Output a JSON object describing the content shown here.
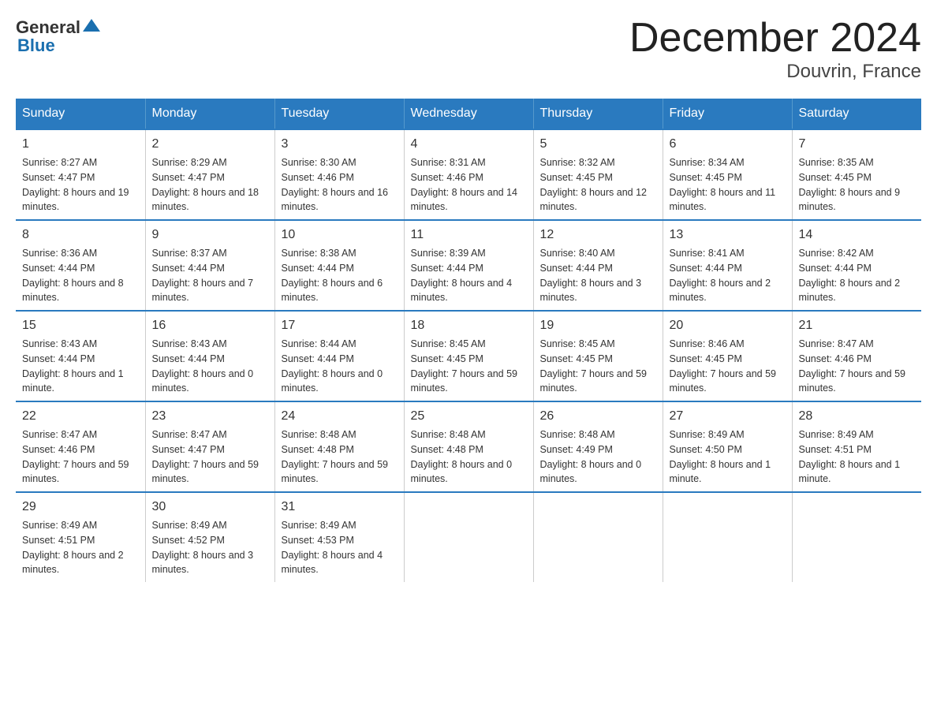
{
  "header": {
    "logo_text1": "General",
    "logo_text2": "Blue",
    "month": "December 2024",
    "location": "Douvrin, France"
  },
  "days_of_week": [
    "Sunday",
    "Monday",
    "Tuesday",
    "Wednesday",
    "Thursday",
    "Friday",
    "Saturday"
  ],
  "weeks": [
    [
      {
        "num": "1",
        "sunrise": "Sunrise: 8:27 AM",
        "sunset": "Sunset: 4:47 PM",
        "daylight": "Daylight: 8 hours and 19 minutes."
      },
      {
        "num": "2",
        "sunrise": "Sunrise: 8:29 AM",
        "sunset": "Sunset: 4:47 PM",
        "daylight": "Daylight: 8 hours and 18 minutes."
      },
      {
        "num": "3",
        "sunrise": "Sunrise: 8:30 AM",
        "sunset": "Sunset: 4:46 PM",
        "daylight": "Daylight: 8 hours and 16 minutes."
      },
      {
        "num": "4",
        "sunrise": "Sunrise: 8:31 AM",
        "sunset": "Sunset: 4:46 PM",
        "daylight": "Daylight: 8 hours and 14 minutes."
      },
      {
        "num": "5",
        "sunrise": "Sunrise: 8:32 AM",
        "sunset": "Sunset: 4:45 PM",
        "daylight": "Daylight: 8 hours and 12 minutes."
      },
      {
        "num": "6",
        "sunrise": "Sunrise: 8:34 AM",
        "sunset": "Sunset: 4:45 PM",
        "daylight": "Daylight: 8 hours and 11 minutes."
      },
      {
        "num": "7",
        "sunrise": "Sunrise: 8:35 AM",
        "sunset": "Sunset: 4:45 PM",
        "daylight": "Daylight: 8 hours and 9 minutes."
      }
    ],
    [
      {
        "num": "8",
        "sunrise": "Sunrise: 8:36 AM",
        "sunset": "Sunset: 4:44 PM",
        "daylight": "Daylight: 8 hours and 8 minutes."
      },
      {
        "num": "9",
        "sunrise": "Sunrise: 8:37 AM",
        "sunset": "Sunset: 4:44 PM",
        "daylight": "Daylight: 8 hours and 7 minutes."
      },
      {
        "num": "10",
        "sunrise": "Sunrise: 8:38 AM",
        "sunset": "Sunset: 4:44 PM",
        "daylight": "Daylight: 8 hours and 6 minutes."
      },
      {
        "num": "11",
        "sunrise": "Sunrise: 8:39 AM",
        "sunset": "Sunset: 4:44 PM",
        "daylight": "Daylight: 8 hours and 4 minutes."
      },
      {
        "num": "12",
        "sunrise": "Sunrise: 8:40 AM",
        "sunset": "Sunset: 4:44 PM",
        "daylight": "Daylight: 8 hours and 3 minutes."
      },
      {
        "num": "13",
        "sunrise": "Sunrise: 8:41 AM",
        "sunset": "Sunset: 4:44 PM",
        "daylight": "Daylight: 8 hours and 2 minutes."
      },
      {
        "num": "14",
        "sunrise": "Sunrise: 8:42 AM",
        "sunset": "Sunset: 4:44 PM",
        "daylight": "Daylight: 8 hours and 2 minutes."
      }
    ],
    [
      {
        "num": "15",
        "sunrise": "Sunrise: 8:43 AM",
        "sunset": "Sunset: 4:44 PM",
        "daylight": "Daylight: 8 hours and 1 minute."
      },
      {
        "num": "16",
        "sunrise": "Sunrise: 8:43 AM",
        "sunset": "Sunset: 4:44 PM",
        "daylight": "Daylight: 8 hours and 0 minutes."
      },
      {
        "num": "17",
        "sunrise": "Sunrise: 8:44 AM",
        "sunset": "Sunset: 4:44 PM",
        "daylight": "Daylight: 8 hours and 0 minutes."
      },
      {
        "num": "18",
        "sunrise": "Sunrise: 8:45 AM",
        "sunset": "Sunset: 4:45 PM",
        "daylight": "Daylight: 7 hours and 59 minutes."
      },
      {
        "num": "19",
        "sunrise": "Sunrise: 8:45 AM",
        "sunset": "Sunset: 4:45 PM",
        "daylight": "Daylight: 7 hours and 59 minutes."
      },
      {
        "num": "20",
        "sunrise": "Sunrise: 8:46 AM",
        "sunset": "Sunset: 4:45 PM",
        "daylight": "Daylight: 7 hours and 59 minutes."
      },
      {
        "num": "21",
        "sunrise": "Sunrise: 8:47 AM",
        "sunset": "Sunset: 4:46 PM",
        "daylight": "Daylight: 7 hours and 59 minutes."
      }
    ],
    [
      {
        "num": "22",
        "sunrise": "Sunrise: 8:47 AM",
        "sunset": "Sunset: 4:46 PM",
        "daylight": "Daylight: 7 hours and 59 minutes."
      },
      {
        "num": "23",
        "sunrise": "Sunrise: 8:47 AM",
        "sunset": "Sunset: 4:47 PM",
        "daylight": "Daylight: 7 hours and 59 minutes."
      },
      {
        "num": "24",
        "sunrise": "Sunrise: 8:48 AM",
        "sunset": "Sunset: 4:48 PM",
        "daylight": "Daylight: 7 hours and 59 minutes."
      },
      {
        "num": "25",
        "sunrise": "Sunrise: 8:48 AM",
        "sunset": "Sunset: 4:48 PM",
        "daylight": "Daylight: 8 hours and 0 minutes."
      },
      {
        "num": "26",
        "sunrise": "Sunrise: 8:48 AM",
        "sunset": "Sunset: 4:49 PM",
        "daylight": "Daylight: 8 hours and 0 minutes."
      },
      {
        "num": "27",
        "sunrise": "Sunrise: 8:49 AM",
        "sunset": "Sunset: 4:50 PM",
        "daylight": "Daylight: 8 hours and 1 minute."
      },
      {
        "num": "28",
        "sunrise": "Sunrise: 8:49 AM",
        "sunset": "Sunset: 4:51 PM",
        "daylight": "Daylight: 8 hours and 1 minute."
      }
    ],
    [
      {
        "num": "29",
        "sunrise": "Sunrise: 8:49 AM",
        "sunset": "Sunset: 4:51 PM",
        "daylight": "Daylight: 8 hours and 2 minutes."
      },
      {
        "num": "30",
        "sunrise": "Sunrise: 8:49 AM",
        "sunset": "Sunset: 4:52 PM",
        "daylight": "Daylight: 8 hours and 3 minutes."
      },
      {
        "num": "31",
        "sunrise": "Sunrise: 8:49 AM",
        "sunset": "Sunset: 4:53 PM",
        "daylight": "Daylight: 8 hours and 4 minutes."
      },
      {
        "num": "",
        "sunrise": "",
        "sunset": "",
        "daylight": ""
      },
      {
        "num": "",
        "sunrise": "",
        "sunset": "",
        "daylight": ""
      },
      {
        "num": "",
        "sunrise": "",
        "sunset": "",
        "daylight": ""
      },
      {
        "num": "",
        "sunrise": "",
        "sunset": "",
        "daylight": ""
      }
    ]
  ]
}
